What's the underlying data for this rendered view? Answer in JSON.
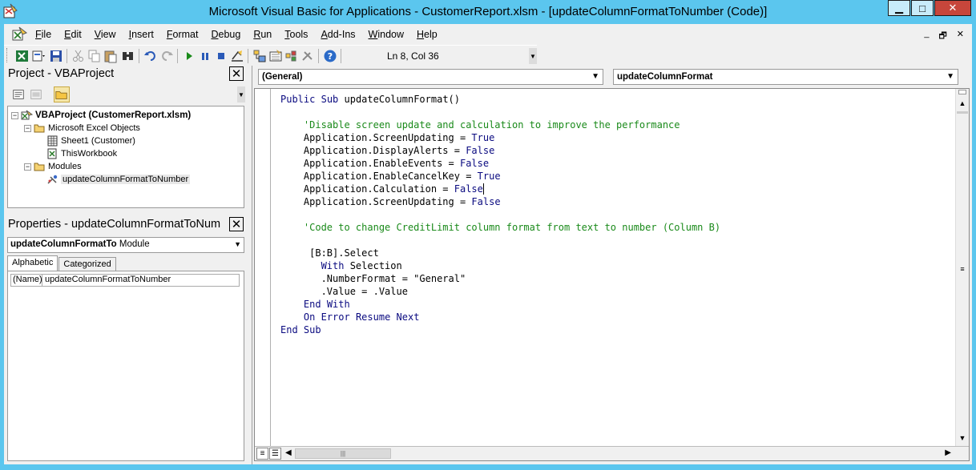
{
  "window": {
    "title": "Microsoft Visual Basic for Applications - CustomerReport.xlsm - [updateColumnFormatToNumber (Code)]",
    "minimize": "▁",
    "maximize": "□",
    "close": "✕"
  },
  "menu": {
    "items": [
      "File",
      "Edit",
      "View",
      "Insert",
      "Format",
      "Debug",
      "Run",
      "Tools",
      "Add-Ins",
      "Window",
      "Help"
    ],
    "mdi_minimize": "_",
    "mdi_restore": "🗗",
    "mdi_close": "✕"
  },
  "toolbar": {
    "cursor_position": "Ln 8, Col 36"
  },
  "project": {
    "title": "Project - VBAProject",
    "close": "✕",
    "tree": {
      "root": "VBAProject (CustomerReport.xlsm)",
      "excel_objects": "Microsoft Excel Objects",
      "sheet1": "Sheet1 (Customer)",
      "this_workbook": "ThisWorkbook",
      "modules": "Modules",
      "module1": "updateColumnFormatToNumber"
    }
  },
  "properties": {
    "title": "Properties - updateColumnFormatToNum",
    "close": "✕",
    "object_name": "updateColumnFormatTo",
    "object_type": "Module",
    "tabs": [
      "Alphabetic",
      "Categorized"
    ],
    "rows": [
      {
        "name": "(Name)",
        "value": "updateColumnFormatToNumber"
      }
    ]
  },
  "code_window": {
    "object_combo": "(General)",
    "procedure_combo": "updateColumnFormat",
    "lines": [
      "Public Sub updateColumnFormat()",
      "",
      "    'Disable screen update and calculation to improve the performance",
      "    Application.ScreenUpdating = True",
      "    Application.DisplayAlerts = False",
      "    Application.EnableEvents = False",
      "    Application.EnableCancelKey = True",
      "    Application.Calculation = False",
      "    Application.ScreenUpdating = False",
      "",
      "    'Code to change CreditLimit column format from text to number (Column B)",
      "",
      "     [B:B].Select",
      "       With Selection",
      "       .NumberFormat = \"General\"",
      "       .Value = .Value",
      "    End With",
      "    On Error Resume Next",
      "End Sub"
    ]
  },
  "colors": {
    "title_bar": "#5bc6ee",
    "keyword": "#0a0a80",
    "comment": "#1a8a1a",
    "close_button": "#c7463b"
  }
}
